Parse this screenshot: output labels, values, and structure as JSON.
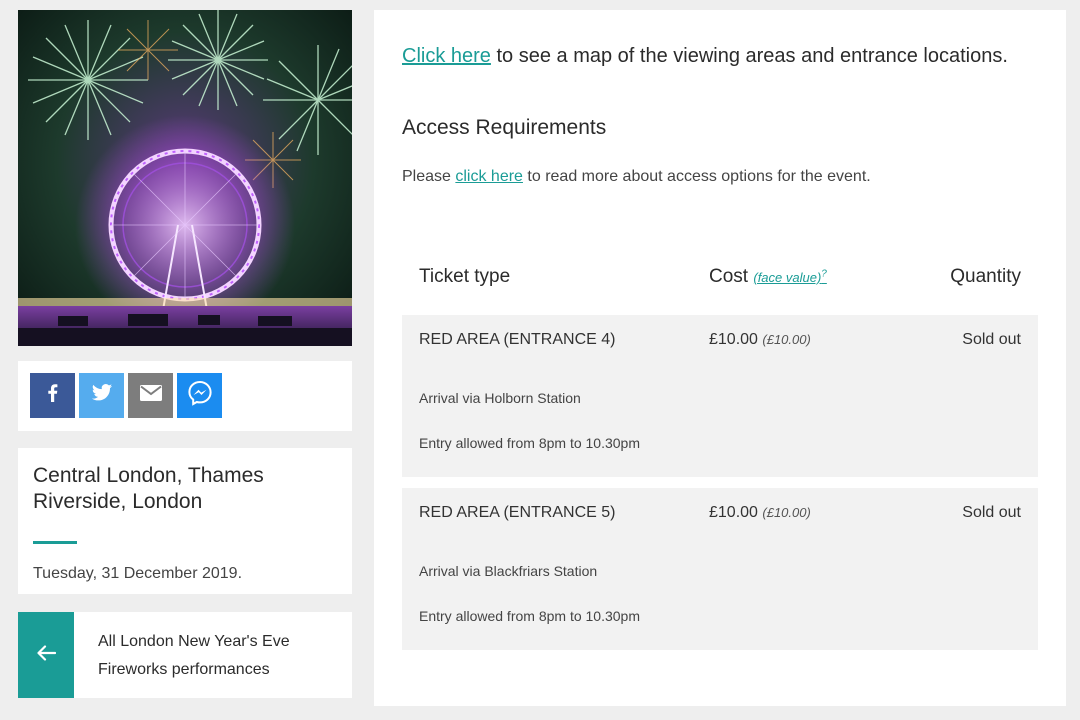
{
  "sidebar": {
    "share": {
      "facebook_icon": "facebook-icon",
      "twitter_icon": "twitter-icon",
      "email_icon": "mail-icon",
      "messenger_icon": "messenger-icon",
      "colors": {
        "facebook": "#3b5998",
        "twitter": "#55acee",
        "email": "#7d7d7d",
        "messenger": "#1b8cf0"
      }
    },
    "venue": {
      "title": "Central London, Thames Riverside, London",
      "date": "Tuesday, 31 December 2019."
    },
    "back_link": {
      "label": "All London New Year's Eve Fireworks performances",
      "icon": "arrow-left-icon"
    }
  },
  "main": {
    "map_link": {
      "link_text": "Click here",
      "rest": " to see a map of the viewing areas and entrance locations."
    },
    "access": {
      "heading": "Access Requirements",
      "prefix": "Please ",
      "link_text": "click here",
      "suffix": " to read more about access options for the event."
    },
    "table": {
      "headers": {
        "type": "Ticket type",
        "cost": "Cost",
        "face_value_link": "(face value)",
        "face_value_sup": "?",
        "quantity": "Quantity"
      },
      "rows": [
        {
          "name": "RED AREA (ENTRANCE 4)",
          "cost": "£10.00",
          "face": "(£10.00)",
          "status": "Sold out",
          "detail1": "Arrival via Holborn Station",
          "detail2": "Entry allowed from 8pm to 10.30pm"
        },
        {
          "name": "RED AREA (ENTRANCE 5)",
          "cost": "£10.00",
          "face": "(£10.00)",
          "status": "Sold out",
          "detail1": "Arrival via Blackfriars Station",
          "detail2": "Entry allowed from 8pm to 10.30pm"
        }
      ]
    }
  },
  "colors": {
    "accent": "#1a9c96",
    "page_bg": "#eeeeee",
    "row_bg": "#f2f2f2"
  }
}
